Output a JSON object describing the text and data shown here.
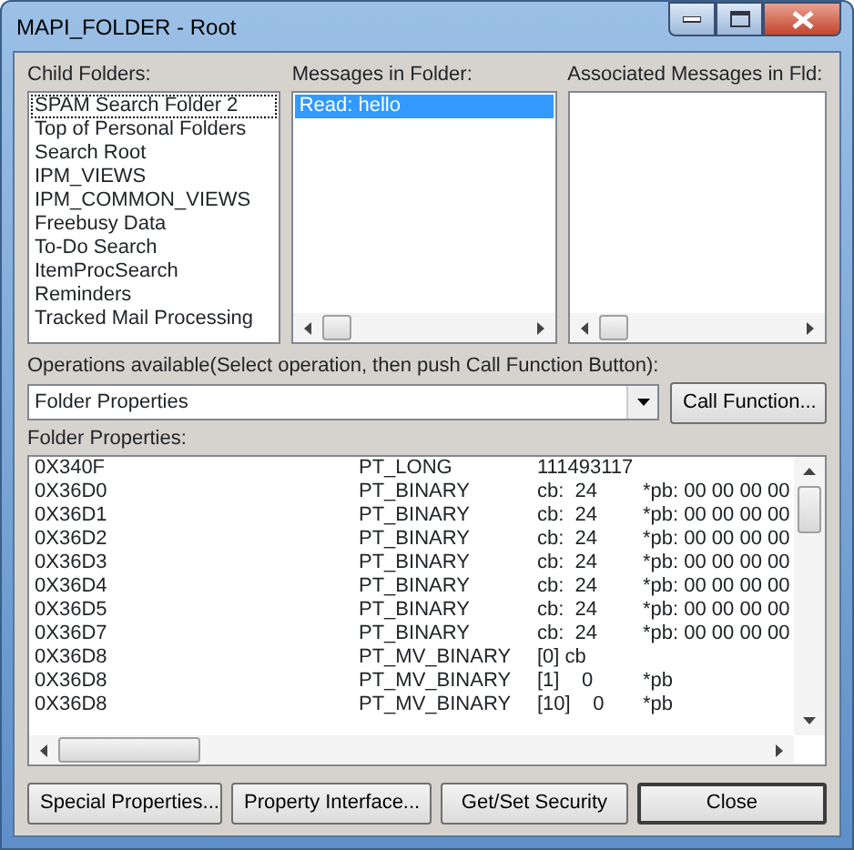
{
  "window": {
    "title": "MAPI_FOLDER - Root"
  },
  "child_folders": {
    "label": "Child Folders:",
    "items": [
      {
        "text": "SPAM Search Folder 2",
        "selected": false,
        "focused": true
      },
      {
        "text": "Top of Personal Folders",
        "selected": false,
        "focused": false
      },
      {
        "text": "Search Root",
        "selected": false,
        "focused": false
      },
      {
        "text": "IPM_VIEWS",
        "selected": false,
        "focused": false
      },
      {
        "text": "IPM_COMMON_VIEWS",
        "selected": false,
        "focused": false
      },
      {
        "text": "Freebusy Data",
        "selected": false,
        "focused": false
      },
      {
        "text": "To-Do Search",
        "selected": false,
        "focused": false
      },
      {
        "text": "ItemProcSearch",
        "selected": false,
        "focused": false
      },
      {
        "text": "Reminders",
        "selected": false,
        "focused": false
      },
      {
        "text": "Tracked Mail Processing",
        "selected": false,
        "focused": false
      }
    ]
  },
  "messages": {
    "label": "Messages in Folder:",
    "items": [
      {
        "text": "Read: hello",
        "selected": true,
        "focused": false
      }
    ]
  },
  "associated": {
    "label": "Associated Messages in Fld:"
  },
  "operations": {
    "label": "Operations available(Select operation, then push Call Function Button):",
    "value": "Folder Properties",
    "button": "Call Function..."
  },
  "properties": {
    "label": "Folder Properties:",
    "rows": [
      [
        "0X340F",
        "PT_LONG",
        "111493117",
        ""
      ],
      [
        "0X36D0",
        "PT_BINARY",
        "cb:  24",
        "*pb: 00 00 00 00"
      ],
      [
        "0X36D1",
        "PT_BINARY",
        "cb:  24",
        "*pb: 00 00 00 00"
      ],
      [
        "0X36D2",
        "PT_BINARY",
        "cb:  24",
        "*pb: 00 00 00 00"
      ],
      [
        "0X36D3",
        "PT_BINARY",
        "cb:  24",
        "*pb: 00 00 00 00"
      ],
      [
        "0X36D4",
        "PT_BINARY",
        "cb:  24",
        "*pb: 00 00 00 00"
      ],
      [
        "0X36D5",
        "PT_BINARY",
        "cb:  24",
        "*pb: 00 00 00 00"
      ],
      [
        "0X36D7",
        "PT_BINARY",
        "cb:  24",
        "*pb: 00 00 00 00"
      ],
      [
        "0X36D8",
        "PT_MV_BINARY",
        "[0] cb",
        ""
      ],
      [
        "0X36D8",
        "PT_MV_BINARY",
        "[1]    0",
        "*pb"
      ],
      [
        "0X36D8",
        "PT_MV_BINARY",
        "[10]    0",
        "*pb"
      ]
    ]
  },
  "buttons": [
    {
      "text": "Special Properties...",
      "default": false
    },
    {
      "text": "Property Interface...",
      "default": false
    },
    {
      "text": "Get/Set Security",
      "default": false
    },
    {
      "text": "Close",
      "default": true
    }
  ]
}
